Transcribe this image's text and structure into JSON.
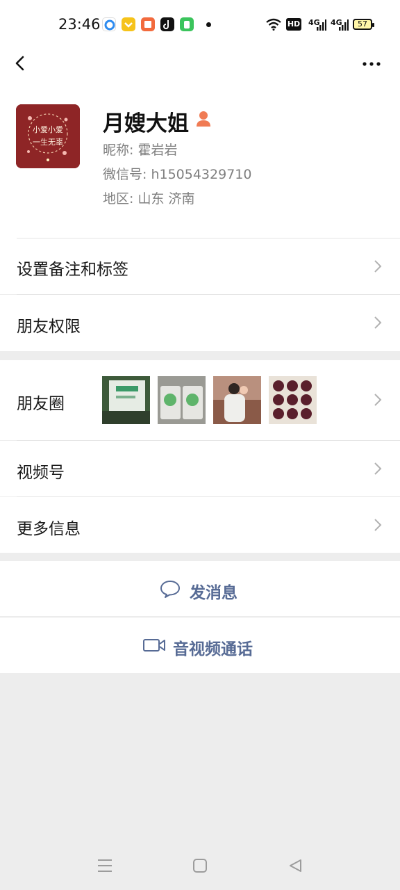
{
  "status_bar": {
    "time": "23:46",
    "network_1": "4G",
    "network_2": "4G",
    "hd_label": "HD",
    "battery": "57"
  },
  "nav": {
    "back_icon": "chevron-left-icon",
    "more_icon": "more-dots-icon"
  },
  "profile": {
    "name": "月嫂大姐",
    "nickname": "昵称:  霍岩岩",
    "wechat_id": "微信号:  h15054329710",
    "region": "地区:  山东  济南",
    "avatar_text_1": "小爱小爱",
    "avatar_text_2": "一生无辜"
  },
  "settings": {
    "remark_label": "设置备注和标签",
    "permission_label": "朋友权限"
  },
  "content": {
    "moments_label": "朋友圈",
    "channels_label": "视频号",
    "more_info_label": "更多信息"
  },
  "actions": {
    "message_label": "发消息",
    "call_label": "音视频通话"
  },
  "colors": {
    "link": "#576b95",
    "background": "#ededed",
    "avatar": "#8e2526"
  }
}
